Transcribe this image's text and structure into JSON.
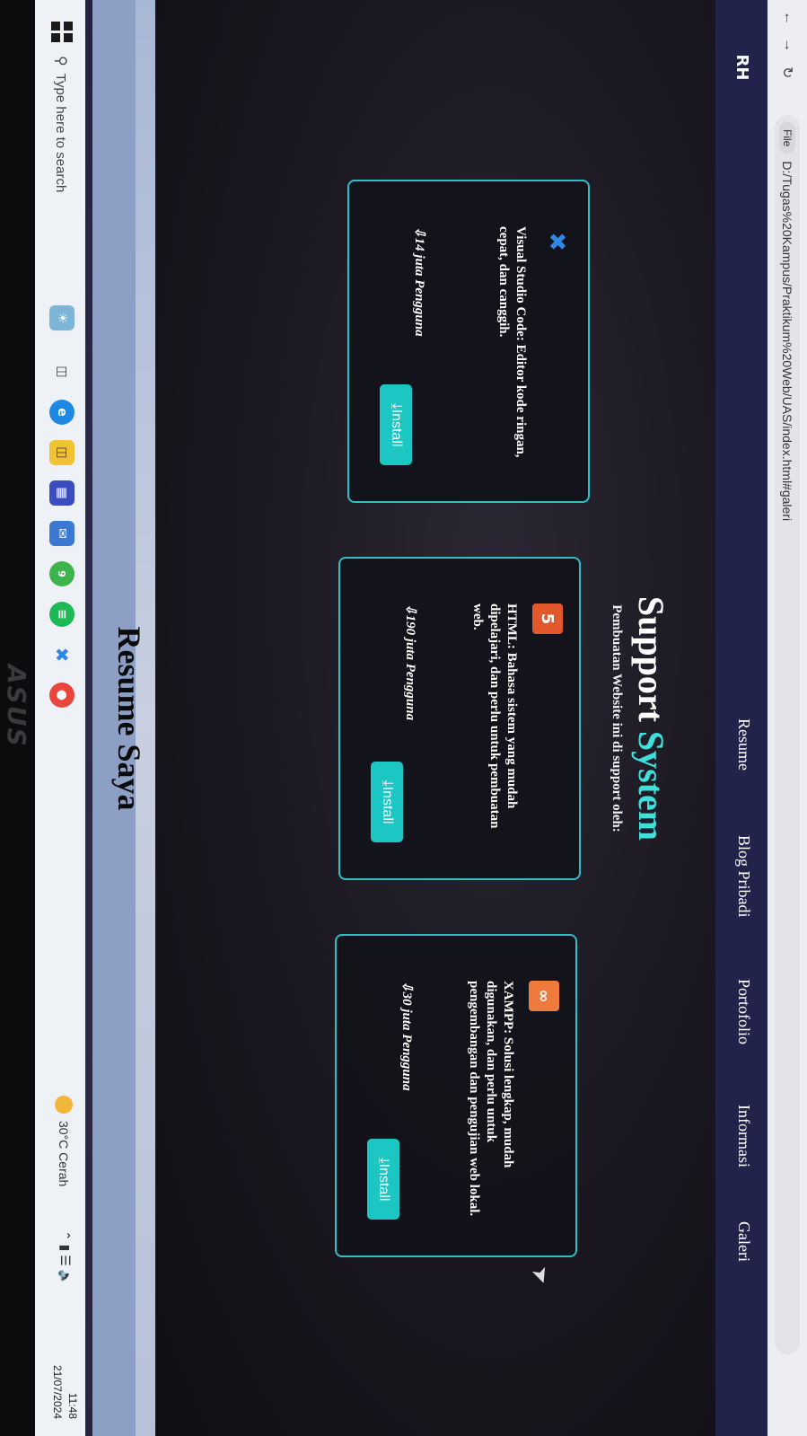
{
  "browser": {
    "file_chip": "File",
    "url": "D:/Tugas%20Kampus/Praktikum%20Web/UAS/index.html#galeri"
  },
  "header": {
    "logo": "RH",
    "nav": [
      "Resume",
      "Blog Pribadi",
      "Portofolio",
      "Informasi",
      "Galeri"
    ]
  },
  "section": {
    "title_part1": "Support",
    "title_part2": "System",
    "subtitle": "Pembuatan Website ini di support oleh:"
  },
  "cards": [
    {
      "icon": "vscode-icon",
      "icon_color": "#2f86e3",
      "description": "Visual Studio Code: Editor kode ringan, cepat, dan canggih.",
      "users": "14 juta Pengguna",
      "install": "Install"
    },
    {
      "icon": "html5-icon",
      "icon_color": "#e2582b",
      "description": "HTML: Bahasa sistem yang mudah dipelajari, dan perlu untuk pembuatan web.",
      "users": "190 juta Pengguna",
      "install": "Install"
    },
    {
      "icon": "xampp-icon",
      "icon_color": "#f07a3c",
      "description": "XAMPP: Solusi lengkap, mudah digunakan, dan perlu untuk pengembangan dan pengujian web lokal.",
      "users": "30 juta Pengguna",
      "install": "Install"
    }
  ],
  "next_section": {
    "title": "Resume Saya"
  },
  "taskbar": {
    "search_placeholder": "Type here to search",
    "weather": "30°C  Cerah",
    "time": "11:48",
    "date": "21/07/2024",
    "badge_count": "9"
  },
  "bezel_brand": "ASUS",
  "colors": {
    "accent": "#3fe0da",
    "button": "#1cc7c3",
    "header": "#22234a"
  }
}
